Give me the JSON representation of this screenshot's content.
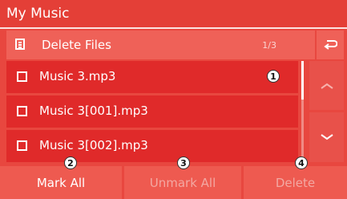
{
  "app": {
    "title": "My Music"
  },
  "header": {
    "title": "Delete Files",
    "page_counter": "1/3"
  },
  "files": [
    {
      "name": "Music 3.mp3",
      "checked": false
    },
    {
      "name": "Music 3[001].mp3",
      "checked": false
    },
    {
      "name": "Music 3[002].mp3",
      "checked": false
    }
  ],
  "actions": {
    "mark_all": "Mark All",
    "unmark_all": "Unmark All",
    "delete": "Delete"
  },
  "callouts": [
    "1",
    "2",
    "3",
    "4"
  ],
  "icons": {
    "header": "list-icon",
    "back": "back-arrow-icon",
    "scroll_up": "chevron-up-icon",
    "scroll_down": "chevron-down-icon"
  },
  "colors": {
    "background": "#e8473f",
    "title_bar": "#e43f37",
    "list_item": "#e02a2a",
    "button": "#ee5a50",
    "text": "#ffffff",
    "disabled_text": "#f3a8a2"
  }
}
